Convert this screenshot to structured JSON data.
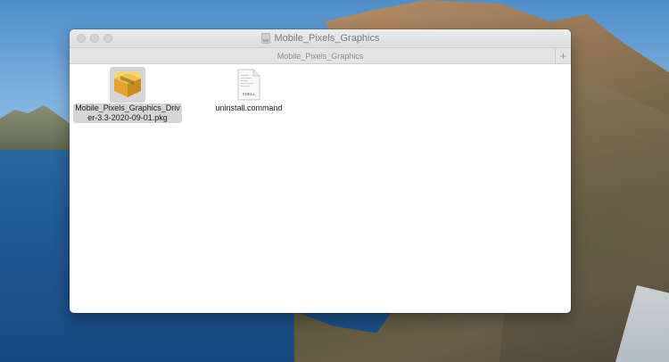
{
  "window": {
    "title": "Mobile_Pixels_Graphics",
    "path_title": "Mobile_Pixels_Graphics",
    "add_tab_label": "+"
  },
  "files": [
    {
      "name_line1": "Mobile_Pixels_Graphics_Driv",
      "name_line2": "er-3.3-2020-09-01.pkg",
      "icon": "package-icon",
      "selected": true
    },
    {
      "name_line1": "uninstall.command",
      "icon": "shell-script-icon",
      "icon_text": "SHELL",
      "selected": false
    }
  ],
  "colors": {
    "selection": "#d6d6d6",
    "package_gold": "#e6a12c"
  }
}
